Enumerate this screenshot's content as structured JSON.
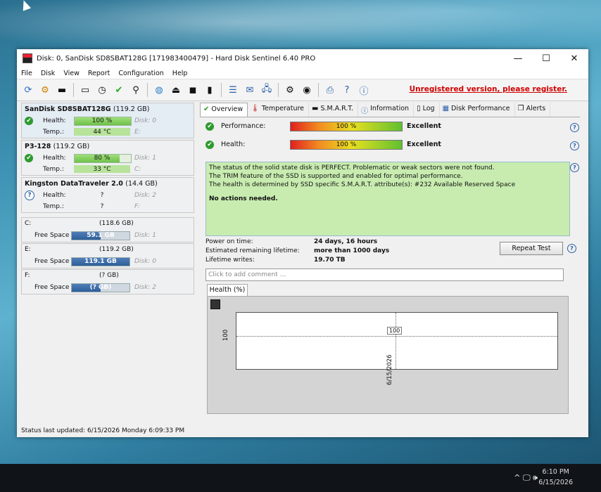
{
  "window": {
    "title": "Disk: 0, SanDisk SD8SBAT128G [171983400479]  -  Hard Disk Sentinel 6.40 PRO",
    "min": "—",
    "max": "☐",
    "close": "✕"
  },
  "menu": [
    "File",
    "Disk",
    "View",
    "Report",
    "Configuration",
    "Help"
  ],
  "toolbar": {
    "unregistered": "Unregistered version, please register."
  },
  "disks": [
    {
      "name": "SanDisk SD8SBAT128G",
      "size": "(119.2 GB)",
      "health_label": "Health:",
      "health": "100 %",
      "health_pct": 100,
      "disk": "Disk: 0",
      "temp_label": "Temp.:",
      "temp": "44 °C",
      "drive": "E:",
      "status": "ok"
    },
    {
      "name": "P3-128",
      "size": "(119.2 GB)",
      "health_label": "Health:",
      "health": "80 %",
      "health_pct": 80,
      "disk": "Disk: 1",
      "temp_label": "Temp.:",
      "temp": "33 °C",
      "drive": "C:",
      "status": "ok"
    },
    {
      "name": "Kingston DataTraveler 2.0",
      "size": "(14.4 GB)",
      "health_label": "Health:",
      "health": "?",
      "health_pct": 0,
      "disk": "Disk: 2",
      "temp_label": "Temp.:",
      "temp": "?",
      "drive": "F:",
      "status": "unknown"
    }
  ],
  "volumes": [
    {
      "letter": "C:",
      "size": "(118.6 GB)",
      "free_label": "Free Space",
      "free": "59.1 GB",
      "free_pct": 50,
      "disk": "Disk: 1"
    },
    {
      "letter": "E:",
      "size": "(119.2 GB)",
      "free_label": "Free Space",
      "free": "119.1 GB",
      "free_pct": 100,
      "disk": "Disk: 0"
    },
    {
      "letter": "F:",
      "size": "(? GB)",
      "free_label": "Free Space",
      "free": "(? GB)",
      "free_pct": 50,
      "disk": "Disk: 2"
    }
  ],
  "status_bar": "Status last updated: 6/15/2026 Monday 6:09:33 PM",
  "tabs": [
    "Overview",
    "Temperature",
    "S.M.A.R.T.",
    "Information",
    "Log",
    "Disk Performance",
    "Alerts"
  ],
  "overview": {
    "performance_label": "Performance:",
    "performance": "100 %",
    "performance_pct": 100,
    "performance_rating": "Excellent",
    "health_label": "Health:",
    "health": "100 %",
    "health_pct": 100,
    "health_rating": "Excellent",
    "status_lines": [
      "The status of the solid state disk is PERFECT. Problematic or weak sectors were not found.",
      "The TRIM feature of the SSD is supported and enabled for optimal performance.",
      "The health is determined by SSD specific S.M.A.R.T. attribute(s):  #232 Available Reserved Space"
    ],
    "actions": "No actions needed.",
    "power_on_label": "Power on time:",
    "power_on": "24 days, 16 hours",
    "lifetime_label": "Estimated remaining lifetime:",
    "lifetime": "more than 1000 days",
    "writes_label": "Lifetime writes:",
    "writes": "19.70 TB",
    "repeat_test": "Repeat Test",
    "comment_placeholder": "Click to add comment ..."
  },
  "chart_tab": "Health (%)",
  "chart_data": {
    "type": "line",
    "x": [
      "6/15/2026"
    ],
    "series": [
      {
        "values": [
          100
        ]
      }
    ],
    "ylabel": "",
    "y_tick": "100",
    "point_label": "100"
  },
  "taskbar": {
    "time": "6:10 PM",
    "date": "6/15/2026",
    "tray": "^  🖵  🕪"
  }
}
